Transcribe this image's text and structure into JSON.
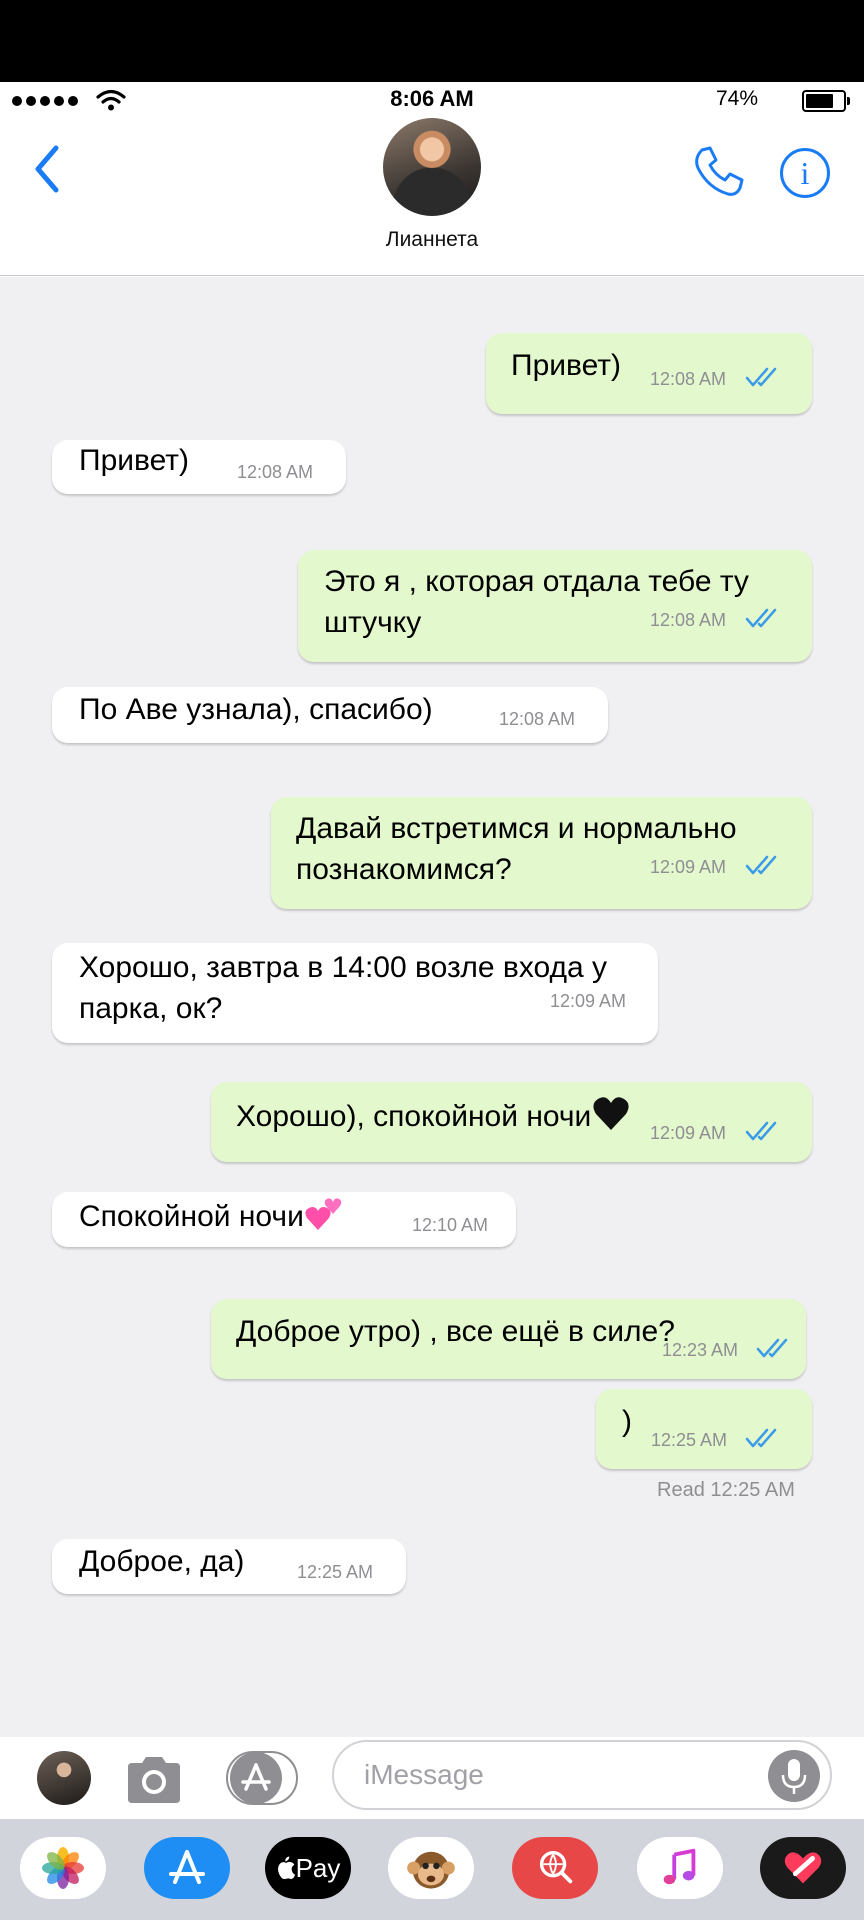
{
  "status": {
    "time": "8:06 AM",
    "battery": "74%",
    "battery_level": 0.74
  },
  "header": {
    "contact_name": "Лианнета"
  },
  "messages": [
    {
      "dir": "out",
      "text": "Привет)",
      "time": "12:08 AM"
    },
    {
      "dir": "in",
      "text": "Привет)",
      "time": "12:08 AM"
    },
    {
      "dir": "out",
      "text": "Это я , которая отдала тебе ту штучку",
      "time": "12:08 AM"
    },
    {
      "dir": "in",
      "text": "По Аве узнала), спасибо)",
      "time": "12:08 AM"
    },
    {
      "dir": "out",
      "text": "Давай встретимся и нормально познакомимся?",
      "time": "12:09 AM"
    },
    {
      "dir": "in",
      "text": "Хорошо, завтра в 14:00 возле входа у парка, ок?",
      "time": "12:09 AM"
    },
    {
      "dir": "out",
      "text": "Хорошо), спокойной ночи",
      "time": "12:09 AM",
      "emoji": "black-heart"
    },
    {
      "dir": "in",
      "text": "Спокойной ночи",
      "time": "12:10 AM",
      "emoji": "two-hearts"
    },
    {
      "dir": "out",
      "text": "Доброе утро) , все ещё в силе?",
      "time": "12:23 AM"
    },
    {
      "dir": "out",
      "text": ")",
      "time": "12:25 AM"
    },
    {
      "dir": "in",
      "text": "Доброе, да)",
      "time": "12:25 AM"
    }
  ],
  "read_receipt": "Read 12:25 AM",
  "compose": {
    "placeholder": "iMessage"
  },
  "dock": {
    "pay_label": "Pay",
    "apps": [
      "photos-icon",
      "app-store-icon",
      "apple-pay-icon",
      "animoji-icon",
      "search-images-icon",
      "music-icon",
      "digital-touch-icon"
    ]
  },
  "colors": {
    "accent": "#1a7cf5",
    "outgoing_bubble": "#e4f8cd",
    "incoming_bubble": "#ffffff",
    "thread_bg": "#f0f0f2",
    "check": "#3a9be8"
  }
}
